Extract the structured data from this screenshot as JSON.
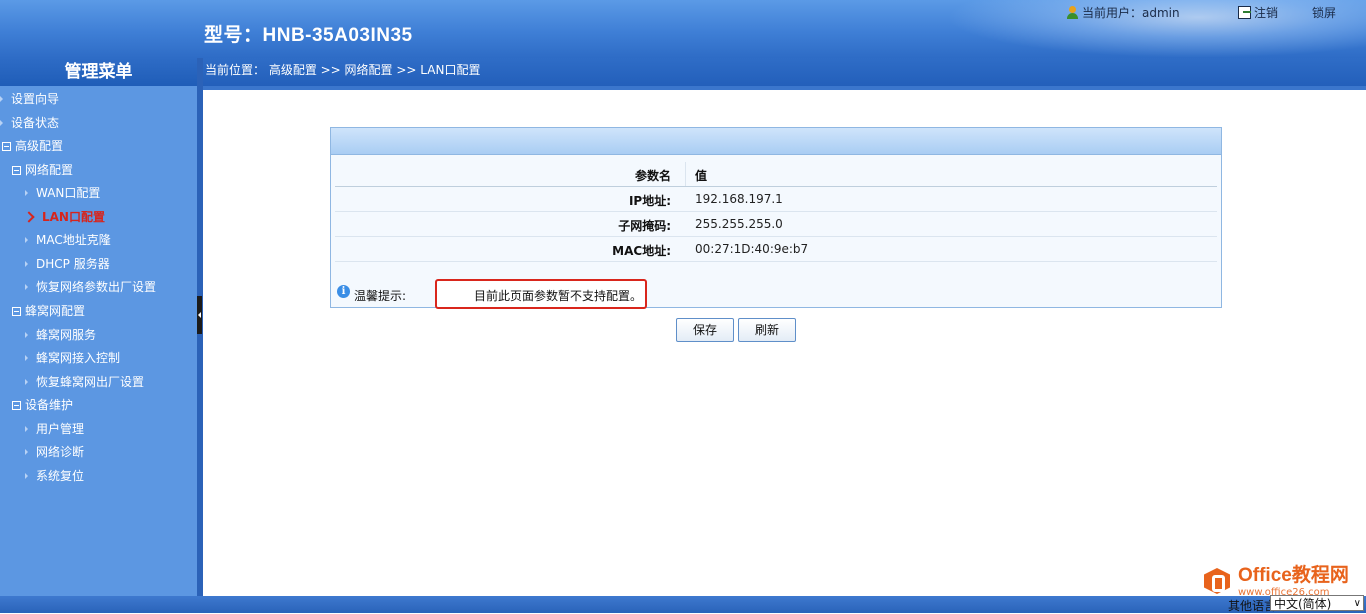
{
  "header": {
    "model": "型号：HNB-35A03IN35",
    "current_user": "当前用户：admin",
    "logout": "注销",
    "lock": "锁屏"
  },
  "sidebar": {
    "title": "管理菜单",
    "items": [
      {
        "label": "设置向导",
        "level": 0,
        "marker": "arrow"
      },
      {
        "label": "设备状态",
        "level": 0,
        "marker": "arrow"
      },
      {
        "label": "高级配置",
        "level": 0,
        "marker": "minus-box"
      },
      {
        "label": "网络配置",
        "level": 1,
        "marker": "minus-box"
      },
      {
        "label": "WAN口配置",
        "level": 2,
        "marker": "arrow"
      },
      {
        "label": "LAN口配置",
        "level": 2,
        "marker": "arrow",
        "active": true
      },
      {
        "label": "MAC地址克隆",
        "level": 2,
        "marker": "arrow"
      },
      {
        "label": "DHCP 服务器",
        "level": 2,
        "marker": "arrow"
      },
      {
        "label": "恢复网络参数出厂设置",
        "level": 2,
        "marker": "arrow"
      },
      {
        "label": "蜂窝网配置",
        "level": 1,
        "marker": "minus-box"
      },
      {
        "label": "蜂窝网服务",
        "level": 2,
        "marker": "arrow"
      },
      {
        "label": "蜂窝网接入控制",
        "level": 2,
        "marker": "arrow"
      },
      {
        "label": "恢复蜂窝网出厂设置",
        "level": 2,
        "marker": "arrow"
      },
      {
        "label": "设备维护",
        "level": 1,
        "marker": "minus-box"
      },
      {
        "label": "用户管理",
        "level": 2,
        "marker": "arrow"
      },
      {
        "label": "网络诊断",
        "level": 2,
        "marker": "arrow"
      },
      {
        "label": "系统复位",
        "level": 2,
        "marker": "arrow"
      }
    ]
  },
  "breadcrumb": "当前位置： 高级配置 >> 网络配置 >> LAN口配置",
  "table": {
    "header": {
      "name": "参数名",
      "value": "值"
    },
    "rows": [
      {
        "name": "IP地址:",
        "value": "192.168.197.1"
      },
      {
        "name": "子网掩码:",
        "value": "255.255.255.0"
      },
      {
        "name": "MAC地址:",
        "value": "00:27:1D:40:9e:b7"
      }
    ]
  },
  "hint": {
    "label": "温馨提示:",
    "text": "目前此页面参数暂不支持配置。"
  },
  "buttons": {
    "save": "保存",
    "refresh": "刷新"
  },
  "footer": {
    "language_label": "其他语言",
    "language_selected": "中文(简体)"
  },
  "watermark": {
    "title": "Office教程网",
    "subtitle": "www.office26.com"
  }
}
